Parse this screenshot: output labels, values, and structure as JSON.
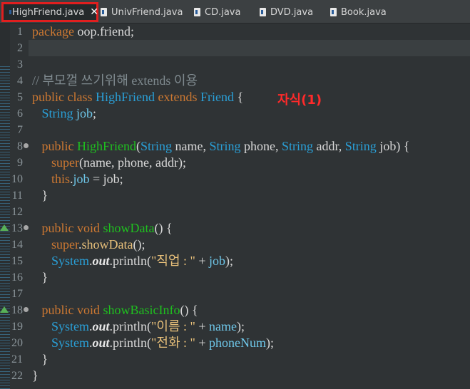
{
  "tabs": [
    {
      "label": "HighFriend.java",
      "active": true,
      "close": "✕"
    },
    {
      "label": "UnivFriend.java",
      "active": false
    },
    {
      "label": "CD.java",
      "active": false
    },
    {
      "label": "DVD.java",
      "active": false
    },
    {
      "label": "Book.java",
      "active": false
    }
  ],
  "annotation": "자식(1)",
  "colors": {
    "keyword": "#cc7832",
    "class": "#2a9fd6",
    "method": "#1fc01f",
    "field": "#6ec6e8",
    "string": "#e8c07a",
    "comment": "#7f8a8f",
    "annotation": "#ff2a2a",
    "tab_highlight": "#e01f1f"
  },
  "lines": [
    {
      "n": "1",
      "tokens": [
        [
          "kw",
          "package"
        ],
        [
          "t",
          " oop.friend;"
        ]
      ]
    },
    {
      "n": "2",
      "tokens": []
    },
    {
      "n": "3",
      "tokens": []
    },
    {
      "n": "4",
      "tokens": [
        [
          "cmt",
          "// 부모껄 쓰기위해 extends 이용"
        ]
      ]
    },
    {
      "n": "5",
      "tokens": [
        [
          "kw",
          "public class "
        ],
        [
          "cls",
          "HighFriend"
        ],
        [
          "kw",
          " extends "
        ],
        [
          "cls",
          "Friend"
        ],
        [
          "t",
          " {"
        ]
      ]
    },
    {
      "n": "6",
      "tokens": [
        [
          "t",
          "   "
        ],
        [
          "cls",
          "String"
        ],
        [
          "t",
          " "
        ],
        [
          "fld",
          "job"
        ],
        [
          "t",
          ";"
        ]
      ]
    },
    {
      "n": "7",
      "tokens": []
    },
    {
      "n": "8",
      "fold": true,
      "tokens": [
        [
          "t",
          "   "
        ],
        [
          "kw",
          "public "
        ],
        [
          "meth",
          "HighFriend"
        ],
        [
          "t",
          "("
        ],
        [
          "cls",
          "String"
        ],
        [
          "t",
          " name, "
        ],
        [
          "cls",
          "String"
        ],
        [
          "t",
          " phone, "
        ],
        [
          "cls",
          "String"
        ],
        [
          "t",
          " addr, "
        ],
        [
          "cls",
          "String"
        ],
        [
          "t",
          " job) {"
        ]
      ]
    },
    {
      "n": "9",
      "tokens": [
        [
          "t",
          "      "
        ],
        [
          "kw",
          "super"
        ],
        [
          "t",
          "(name, phone, addr);"
        ]
      ]
    },
    {
      "n": "10",
      "tokens": [
        [
          "t",
          "      "
        ],
        [
          "kw",
          "this"
        ],
        [
          "t",
          "."
        ],
        [
          "fld",
          "job"
        ],
        [
          "t",
          " = job;"
        ]
      ]
    },
    {
      "n": "11",
      "tokens": [
        [
          "t",
          "   }"
        ]
      ]
    },
    {
      "n": "12",
      "tokens": []
    },
    {
      "n": "13",
      "fold": true,
      "override": true,
      "tokens": [
        [
          "t",
          "   "
        ],
        [
          "kw",
          "public void "
        ],
        [
          "meth",
          "showData"
        ],
        [
          "t",
          "() {"
        ]
      ]
    },
    {
      "n": "14",
      "tokens": [
        [
          "t",
          "      "
        ],
        [
          "kw",
          "super"
        ],
        [
          "t",
          "."
        ],
        [
          "str",
          "showData"
        ],
        [
          "t",
          "();"
        ]
      ]
    },
    {
      "n": "15",
      "tokens": [
        [
          "t",
          "      "
        ],
        [
          "cls",
          "System"
        ],
        [
          "t",
          "."
        ],
        [
          "out",
          "out"
        ],
        [
          "t",
          ".println("
        ],
        [
          "str",
          "\"직업 : \""
        ],
        [
          "t",
          " + "
        ],
        [
          "fld",
          "job"
        ],
        [
          "t",
          ");"
        ]
      ]
    },
    {
      "n": "16",
      "tokens": [
        [
          "t",
          "   }"
        ]
      ]
    },
    {
      "n": "17",
      "tokens": []
    },
    {
      "n": "18",
      "fold": true,
      "override": true,
      "tokens": [
        [
          "t",
          "   "
        ],
        [
          "kw",
          "public void "
        ],
        [
          "meth",
          "showBasicInfo"
        ],
        [
          "t",
          "() {"
        ]
      ]
    },
    {
      "n": "19",
      "tokens": [
        [
          "t",
          "      "
        ],
        [
          "cls",
          "System"
        ],
        [
          "t",
          "."
        ],
        [
          "out",
          "out"
        ],
        [
          "t",
          ".println("
        ],
        [
          "str",
          "\"이름 : \""
        ],
        [
          "t",
          " + "
        ],
        [
          "fld",
          "name"
        ],
        [
          "t",
          ");"
        ]
      ]
    },
    {
      "n": "20",
      "tokens": [
        [
          "t",
          "      "
        ],
        [
          "cls",
          "System"
        ],
        [
          "t",
          "."
        ],
        [
          "out",
          "out"
        ],
        [
          "t",
          ".println("
        ],
        [
          "str",
          "\"전화 : \""
        ],
        [
          "t",
          " + "
        ],
        [
          "fld",
          "phoneNum"
        ],
        [
          "t",
          ");"
        ]
      ]
    },
    {
      "n": "21",
      "tokens": [
        [
          "t",
          "   }"
        ]
      ]
    },
    {
      "n": "22",
      "tokens": [
        [
          "t",
          "}"
        ]
      ]
    }
  ]
}
